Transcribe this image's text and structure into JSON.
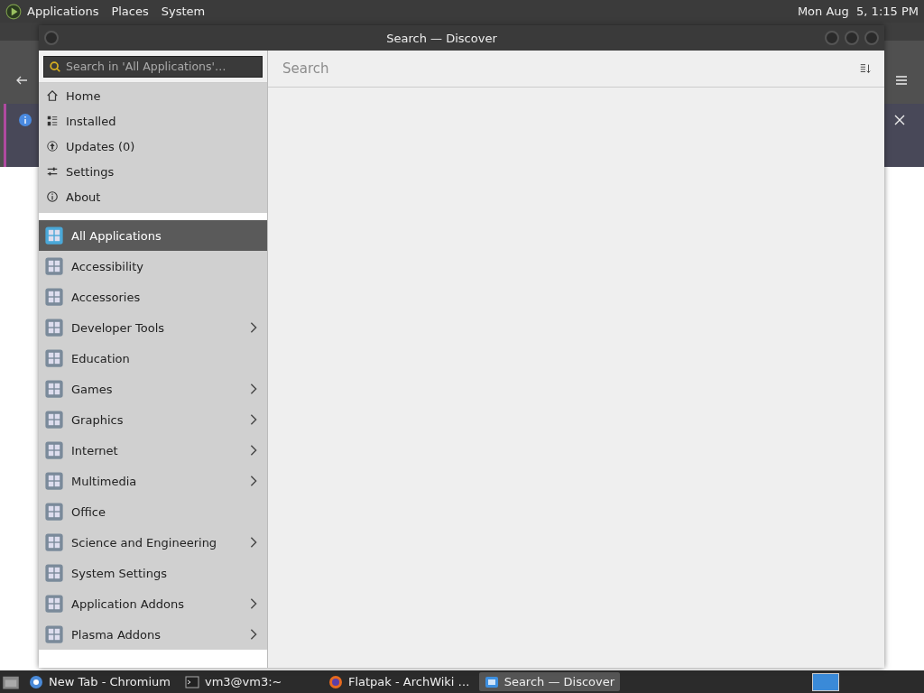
{
  "top_panel": {
    "menus": [
      "Applications",
      "Places",
      "System"
    ],
    "clock": "Mon Aug  5, 1:15 PM"
  },
  "window": {
    "title": "Search — Discover"
  },
  "search": {
    "placeholder": "Search in 'All Applications'…"
  },
  "nav_items": [
    {
      "label": "Home"
    },
    {
      "label": "Installed"
    },
    {
      "label": "Updates (0)"
    },
    {
      "label": "Settings"
    },
    {
      "label": "About"
    }
  ],
  "categories": [
    {
      "label": "All Applications",
      "selected": true,
      "expandable": false
    },
    {
      "label": "Accessibility",
      "selected": false,
      "expandable": false
    },
    {
      "label": "Accessories",
      "selected": false,
      "expandable": false
    },
    {
      "label": "Developer Tools",
      "selected": false,
      "expandable": true
    },
    {
      "label": "Education",
      "selected": false,
      "expandable": false
    },
    {
      "label": "Games",
      "selected": false,
      "expandable": true
    },
    {
      "label": "Graphics",
      "selected": false,
      "expandable": true
    },
    {
      "label": "Internet",
      "selected": false,
      "expandable": true
    },
    {
      "label": "Multimedia",
      "selected": false,
      "expandable": true
    },
    {
      "label": "Office",
      "selected": false,
      "expandable": false
    },
    {
      "label": "Science and Engineering",
      "selected": false,
      "expandable": true
    },
    {
      "label": "System Settings",
      "selected": false,
      "expandable": false
    },
    {
      "label": "Application Addons",
      "selected": false,
      "expandable": true
    },
    {
      "label": "Plasma Addons",
      "selected": false,
      "expandable": true
    }
  ],
  "page_header": {
    "title": "Search"
  },
  "taskbar": {
    "tasks": [
      {
        "label": "New Tab - Chromium",
        "selected": false
      },
      {
        "label": "vm3@vm3:~",
        "selected": false
      },
      {
        "label": "Flatpak - ArchWiki …",
        "selected": false
      },
      {
        "label": "Search — Discover",
        "selected": true
      }
    ]
  }
}
